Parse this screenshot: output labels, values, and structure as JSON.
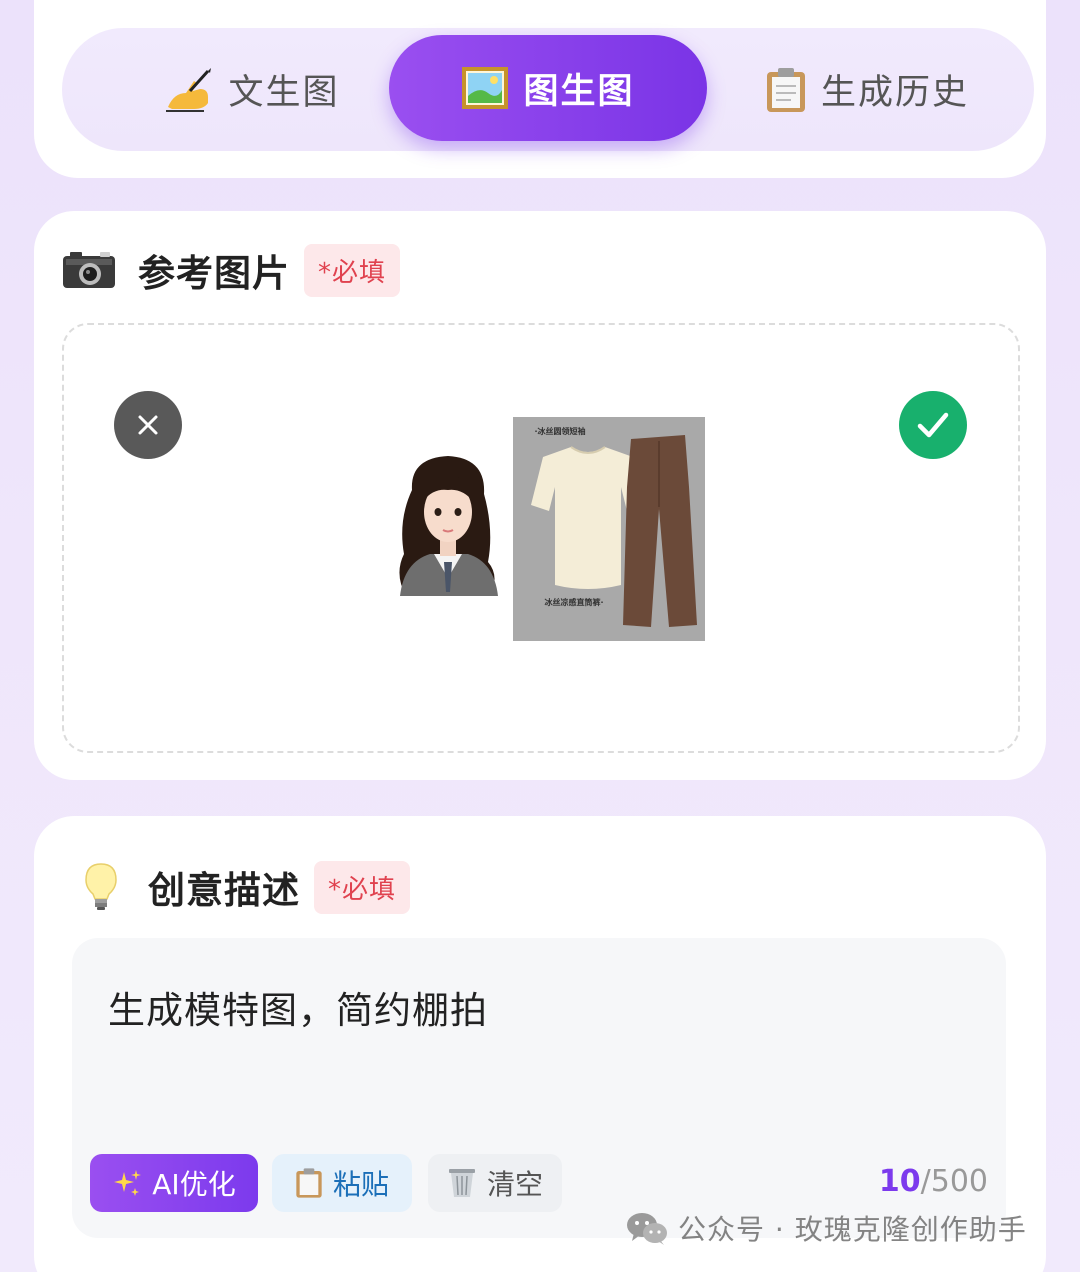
{
  "tabs": [
    {
      "label": "文生图",
      "icon": "writing-hand-icon",
      "active": false
    },
    {
      "label": "图生图",
      "icon": "framed-picture-icon",
      "active": true
    },
    {
      "label": "生成历史",
      "icon": "clipboard-icon",
      "active": false
    }
  ],
  "reference": {
    "title": "参考图片",
    "required_label": "*必填",
    "icon": "camera-icon",
    "outfit_captions": [
      "·冰丝圆领短袖",
      "冰丝凉感直筒裤·"
    ],
    "remove_icon": "close-icon",
    "confirm_icon": "checkmark-icon"
  },
  "description": {
    "title": "创意描述",
    "required_label": "*必填",
    "icon": "lightbulb-icon",
    "text": "生成模特图，简约棚拍",
    "buttons": {
      "ai": "AI优化",
      "paste": "粘贴",
      "clear": "清空"
    },
    "count_current": "10",
    "count_max": "/500"
  },
  "watermark": "公众号 · 玫瑰克隆创作助手",
  "colors": {
    "accent": "#7c3aed",
    "confirm": "#18b06d",
    "required": "#e0424f"
  }
}
